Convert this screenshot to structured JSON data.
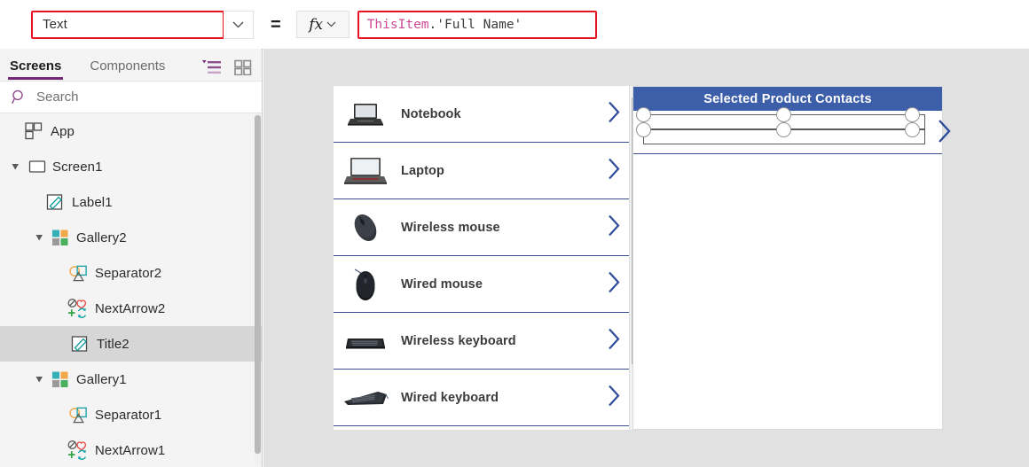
{
  "formula_bar": {
    "property_value": "Text",
    "property_chevron_icon": "chevron-down-icon",
    "equals": "=",
    "fx_label": "fx",
    "fx_chevron_icon": "chevron-down-icon",
    "formula_tokens": [
      {
        "text": "ThisItem",
        "kind": "identifier"
      },
      {
        "text": ".'Full Name'",
        "kind": "plain"
      }
    ],
    "highlight_color": "#e81123",
    "identifier_color": "#cc4a96"
  },
  "sidebar": {
    "tabs": [
      {
        "label": "Screens",
        "active": true
      },
      {
        "label": "Components",
        "active": false
      }
    ],
    "view_icons": [
      {
        "name": "tree-view-icon"
      },
      {
        "name": "thumbnail-view-icon"
      }
    ],
    "search": {
      "icon": "search-icon",
      "placeholder": "Search",
      "value": ""
    },
    "accent_color": "#742774",
    "tree": [
      {
        "label": "App",
        "icon": "app-icon",
        "depth": 0,
        "caret": "none",
        "selected": false
      },
      {
        "label": "Screen1",
        "icon": "screen-icon",
        "depth": 0,
        "caret": "open",
        "selected": false
      },
      {
        "label": "Label1",
        "icon": "label-icon",
        "depth": 1,
        "caret": "none",
        "selected": false
      },
      {
        "label": "Gallery2",
        "icon": "gallery-icon",
        "depth": 1,
        "caret": "open",
        "selected": false
      },
      {
        "label": "Separator2",
        "icon": "separator-icon",
        "depth": 2,
        "caret": "none",
        "selected": false
      },
      {
        "label": "NextArrow2",
        "icon": "next-arrow-icon",
        "depth": 2,
        "caret": "none",
        "selected": false
      },
      {
        "label": "Title2",
        "icon": "label-icon",
        "depth": 2,
        "caret": "none",
        "selected": true
      },
      {
        "label": "Gallery1",
        "icon": "gallery-icon",
        "depth": 1,
        "caret": "open",
        "selected": false
      },
      {
        "label": "Separator1",
        "icon": "separator-icon",
        "depth": 2,
        "caret": "none",
        "selected": false
      },
      {
        "label": "NextArrow1",
        "icon": "next-arrow-icon",
        "depth": 2,
        "caret": "none",
        "selected": false
      }
    ]
  },
  "canvas": {
    "background_color": "#e1e1e1",
    "product_gallery": {
      "items": [
        {
          "label": "Notebook",
          "image": "notebook-image"
        },
        {
          "label": "Laptop",
          "image": "laptop-image"
        },
        {
          "label": "Wireless mouse",
          "image": "wireless-mouse-image"
        },
        {
          "label": "Wired mouse",
          "image": "wired-mouse-image"
        },
        {
          "label": "Wireless keyboard",
          "image": "wireless-keyboard-image"
        },
        {
          "label": "Wired keyboard",
          "image": "wired-keyboard-image"
        }
      ],
      "chevron_icon": "chevron-right-icon",
      "separator_color": "#3c4f92",
      "scrollbar": {
        "up_icon": "scroll-up-arrow-icon",
        "down_icon": "scroll-down-arrow-icon"
      }
    },
    "contacts_gallery": {
      "header_title": "Selected Product Contacts",
      "header_color": "#3d5fa9",
      "chevron_icon": "chevron-right-icon",
      "selection": {
        "handle_count": 6,
        "handle_icon": "resize-handle"
      }
    }
  }
}
